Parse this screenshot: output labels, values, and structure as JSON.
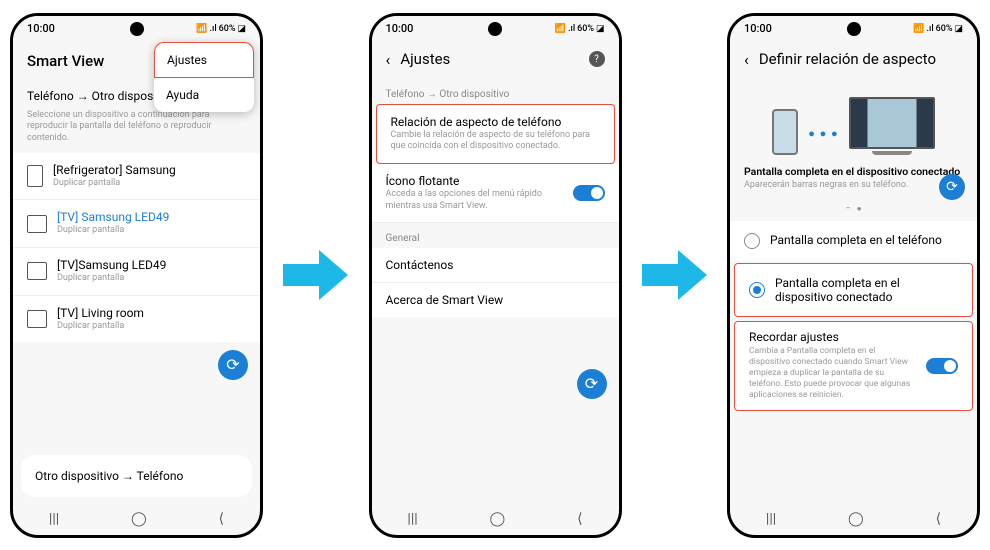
{
  "status": {
    "time": "10:00",
    "battery": "60%",
    "icons": "📶 📊 .ıl"
  },
  "screen1": {
    "title": "Smart View",
    "dropdown": {
      "settings": "Ajustes",
      "help": "Ayuda"
    },
    "tab1": "Teléfono → Otro dispositivo",
    "tab1_desc": "Seleccione un dispositivo a continuación para reproducir la pantalla del teléfono o reproducir contenido.",
    "devices": [
      {
        "name": "[Refrigerator] Samsung",
        "sub": "Duplicar pantalla"
      },
      {
        "name": "[TV] Samsung LED49",
        "sub": "Duplicar pantalla"
      },
      {
        "name": "[TV]Samsung LED49",
        "sub": "Duplicar pantalla"
      },
      {
        "name": "[TV] Living room",
        "sub": "Duplicar pantalla"
      }
    ],
    "tab2": "Otro dispositivo → Teléfono"
  },
  "screen2": {
    "title": "Ajustes",
    "section1": "Teléfono → Otro dispositivo",
    "aspect": {
      "title": "Relación de aspecto de teléfono",
      "sub": "Cambie la relación de aspecto de su teléfono para que coincida con el dispositivo conectado."
    },
    "floating": {
      "title": "Ícono flotante",
      "sub": "Acceda a las opciones del menú rápido mientras usa Smart View."
    },
    "section2": "General",
    "contact": "Contáctenos",
    "about": "Acerca de Smart View"
  },
  "screen3": {
    "title": "Definir relación de aspecto",
    "illus_title": "Pantalla completa en el dispositivo conectado",
    "illus_sub": "Aparecerán barras negras en su teléfono.",
    "option1": "Pantalla completa en el teléfono",
    "option2": "Pantalla completa en el dispositivo conectado",
    "remember": {
      "title": "Recordar ajustes",
      "sub": "Cambia a Pantalla completa en el dispositivo conectado cuando Smart View empieza a duplicar la pantalla de su teléfono. Esto puede provocar que algunas aplicaciones se reinicien."
    }
  },
  "nav": {
    "recent": "|||",
    "home": "◯",
    "back": "⟨"
  }
}
